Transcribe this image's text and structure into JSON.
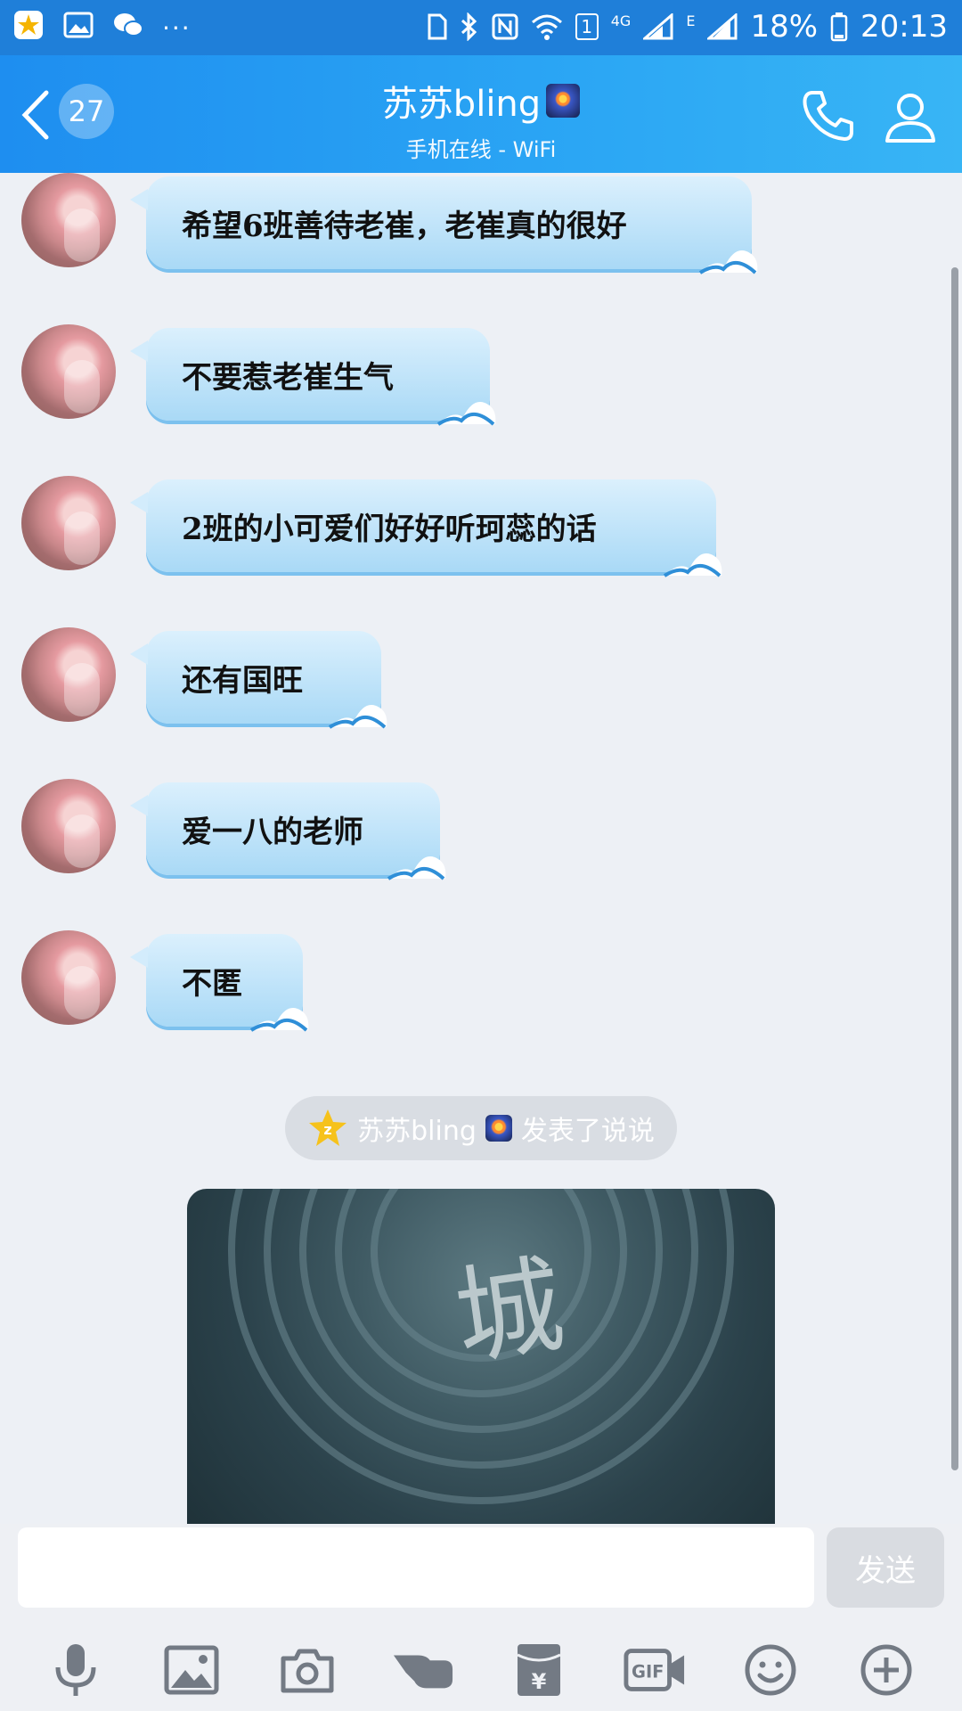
{
  "status_bar": {
    "time": "20:13",
    "battery": "18%",
    "network": "4G",
    "network2": "E",
    "sim_slot": "1",
    "more": "..."
  },
  "header": {
    "unread_count": "27",
    "contact_name": "苏苏bling",
    "status": "手机在线 - WiFi"
  },
  "messages": [
    {
      "text": "希望6班善待老崔，老崔真的很好"
    },
    {
      "text": "不要惹老崔生气"
    },
    {
      "text": "2班的小可爱们好好听珂蕊的话"
    },
    {
      "text": "还有国旺"
    },
    {
      "text": "爱一八的老师"
    },
    {
      "text": "不匿"
    }
  ],
  "system_notice": {
    "name": "苏苏bling",
    "action": "发表了说说"
  },
  "shared_image": {
    "caption": "城"
  },
  "composer": {
    "input_value": "",
    "send_label": "发送"
  },
  "icons": {
    "toolbar": [
      "microphone-icon",
      "image-icon",
      "camera-icon",
      "poke-icon",
      "red-envelope-icon",
      "gif-icon",
      "emoji-icon",
      "plus-icon"
    ]
  },
  "colors": {
    "header_start": "#1e8ef0",
    "header_end": "#38b5f5",
    "bubble": "#a9d9f6",
    "background": "#edf0f5"
  }
}
